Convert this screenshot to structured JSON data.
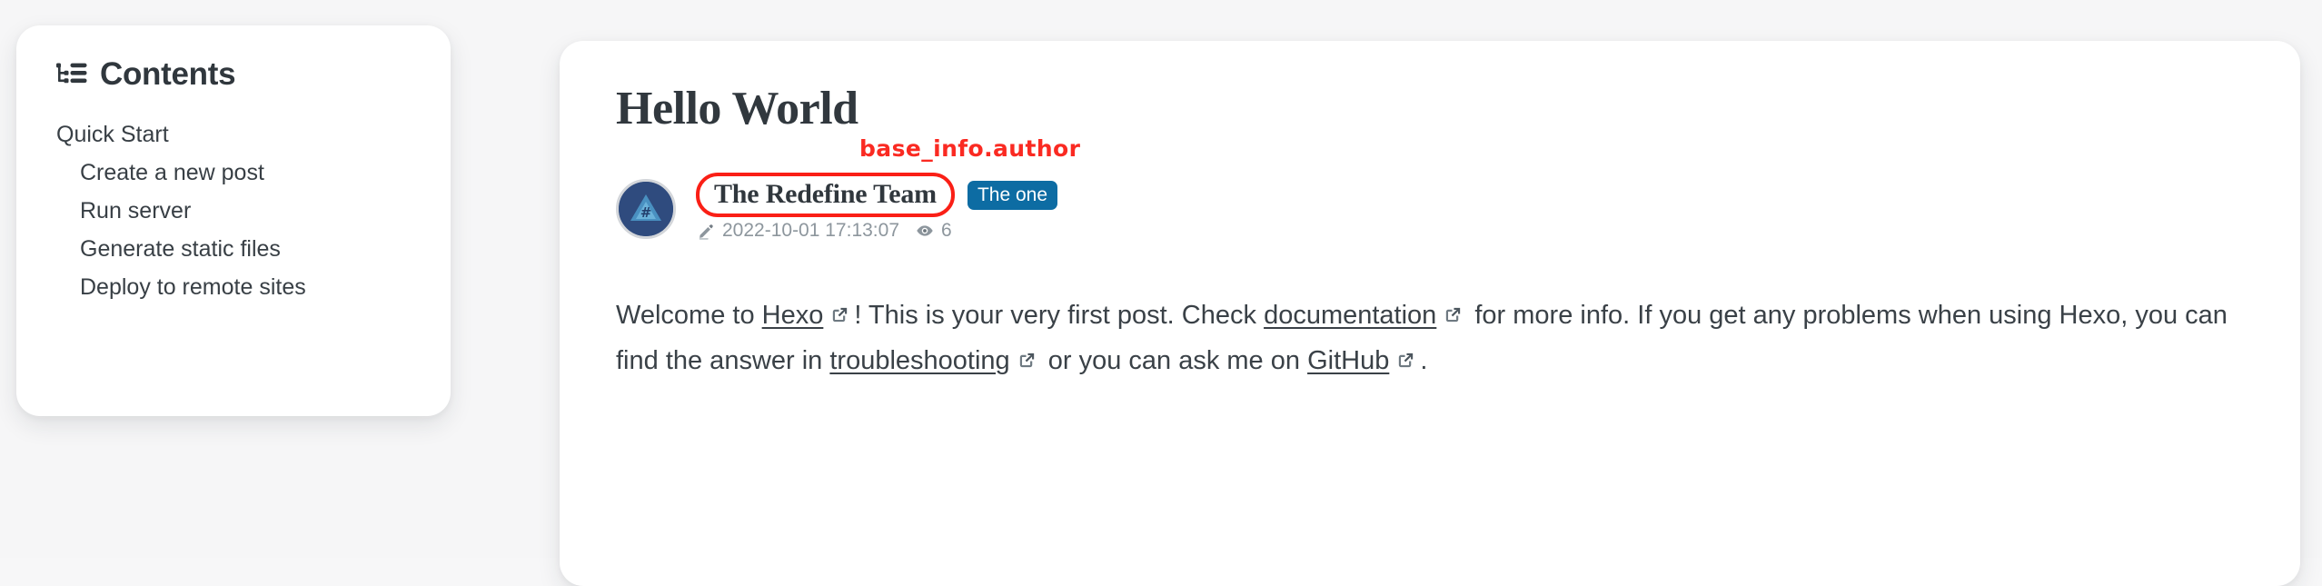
{
  "toc": {
    "title": "Contents",
    "icon": "list-tree-icon",
    "items": [
      {
        "label": "Quick Start",
        "level": 1
      },
      {
        "label": "Create a new post",
        "level": 2
      },
      {
        "label": "Run server",
        "level": 2
      },
      {
        "label": "Generate static files",
        "level": 2
      },
      {
        "label": "Deploy to remote sites",
        "level": 2
      }
    ]
  },
  "post": {
    "title": "Hello World",
    "author": {
      "name": "The Redefine Team",
      "badge": "The one",
      "avatar_symbol": "#"
    },
    "annotation": "base_info.author",
    "stats": {
      "date_icon": "pencil-icon",
      "date": "2022-10-01 17:13:07",
      "views_icon": "eye-icon",
      "views": "6"
    },
    "body": {
      "p1_seg1": "Welcome to ",
      "p1_link1": "Hexo",
      "p1_seg2": "! This is your very first post. Check ",
      "p1_link2": "documentation",
      "p1_seg3": " for more info. If you get any problems when using Hexo, you can find the answer in ",
      "p1_link3": "troubleshooting",
      "p1_seg4": " or you can ask me on ",
      "p1_link4": "GitHub",
      "p1_seg5": "."
    }
  },
  "colors": {
    "page_background": "#f6f6f7",
    "card_background": "#ffffff",
    "text": "#3a4147",
    "heading": "#31383e",
    "badge_blue": "#0d6ca3",
    "annotation_red": "#fa2a22",
    "highlight_red": "#fa1f16",
    "muted": "#8d969d",
    "avatar_blue": "#2f4b7e"
  }
}
